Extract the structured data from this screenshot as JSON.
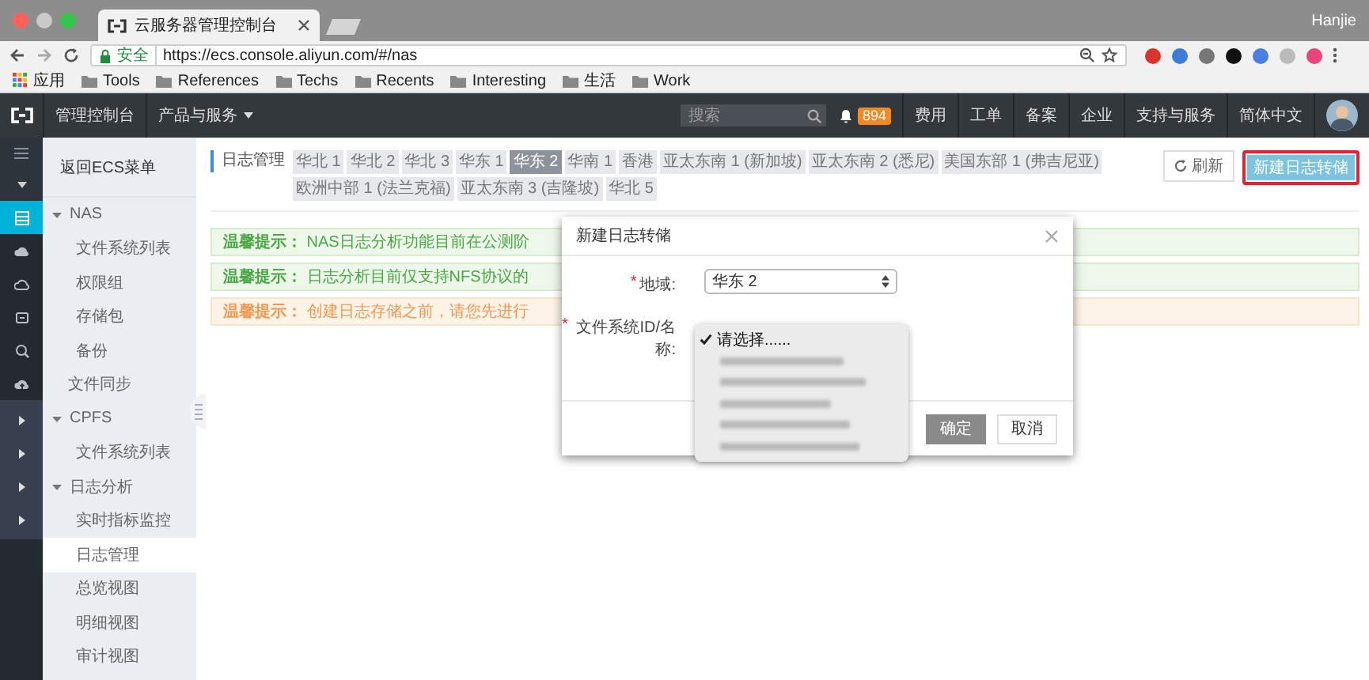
{
  "browser": {
    "tab_title": "云服务器管理控制台",
    "profile_name": "Hanjie",
    "security_label": "安全",
    "url": "https://ecs.console.aliyun.com/#/nas",
    "bookmarks": [
      {
        "label": "应用",
        "kind": "apps"
      },
      {
        "label": "Tools",
        "kind": "folder"
      },
      {
        "label": "References",
        "kind": "folder"
      },
      {
        "label": "Techs",
        "kind": "folder"
      },
      {
        "label": "Recents",
        "kind": "folder"
      },
      {
        "label": "Interesting",
        "kind": "folder"
      },
      {
        "label": "生活",
        "kind": "folder"
      },
      {
        "label": "Work",
        "kind": "folder"
      }
    ]
  },
  "console": {
    "home_label": "管理控制台",
    "products_label": "产品与服务",
    "search": {
      "placeholder": "搜索"
    },
    "notification_count": "894",
    "links": [
      "费用",
      "工单",
      "备案",
      "企业",
      "支持与服务",
      "简体中文"
    ]
  },
  "icon_rail": {
    "items": [
      {
        "selected": true
      },
      {
        "selected": false
      },
      {
        "selected": false
      },
      {
        "selected": false
      },
      {
        "selected": false
      },
      {
        "selected": false
      }
    ]
  },
  "sidebar": {
    "back_label": "返回ECS菜单",
    "items": [
      {
        "label": "NAS",
        "expanded": true,
        "selected": false,
        "children": [
          {
            "label": "文件系统列表",
            "selected": false
          },
          {
            "label": "权限组",
            "selected": false
          },
          {
            "label": "存储包",
            "selected": false
          },
          {
            "label": "备份",
            "selected": false
          }
        ]
      },
      {
        "label": "文件同步",
        "selected": false
      },
      {
        "label": "CPFS",
        "expanded": true,
        "selected": false,
        "children": [
          {
            "label": "文件系统列表",
            "selected": false
          }
        ]
      },
      {
        "label": "日志分析",
        "expanded": true,
        "selected": false,
        "children": [
          {
            "label": "实时指标监控",
            "selected": false
          },
          {
            "label": "日志管理",
            "selected": true
          },
          {
            "label": "总览视图",
            "selected": false
          },
          {
            "label": "明细视图",
            "selected": false
          },
          {
            "label": "审计视图",
            "selected": false
          }
        ]
      }
    ]
  },
  "main": {
    "title": "日志管理",
    "region_tabs": [
      {
        "label": "华北 1",
        "selected": false
      },
      {
        "label": "华北 2",
        "selected": false
      },
      {
        "label": "华北 3",
        "selected": false
      },
      {
        "label": "华东 1",
        "selected": false
      },
      {
        "label": "华东 2",
        "selected": true
      },
      {
        "label": "华南 1",
        "selected": false
      },
      {
        "label": "香港",
        "selected": false
      },
      {
        "label": "亚太东南 1 (新加坡)",
        "selected": false
      },
      {
        "label": "亚太东南 2 (悉尼)",
        "selected": false
      },
      {
        "label": "美国东部 1 (弗吉尼亚)",
        "selected": false
      },
      {
        "label": "欧洲中部 1 (法兰克福)",
        "selected": false
      },
      {
        "label": "亚太东南 3 (吉隆坡)",
        "selected": false
      },
      {
        "label": "华北 5",
        "selected": false
      }
    ],
    "refresh_label": "刷新",
    "create_label": "新建日志转储",
    "notices": [
      {
        "kind": "info",
        "text": "**温馨提示：** NAS日志分析功能目前在公测阶"
      },
      {
        "kind": "info",
        "text": "**温馨提示：** 日志分析目前仅支持NFS协议的"
      },
      {
        "kind": "warning",
        "text": "**温馨提示：** 创建日志存储之前，请您先进行"
      }
    ]
  },
  "dialog": {
    "title": "新建日志转储",
    "fields": [
      {
        "label": "地域:",
        "required_mark": "*",
        "value": "华东 2"
      },
      {
        "label": "文件系统ID/名称:",
        "required_mark": "*"
      }
    ],
    "dropdown": {
      "options": [
        {
          "kind": "text",
          "label": "请选择......",
          "checked": true
        },
        {
          "kind": "redacted",
          "checked": false
        },
        {
          "kind": "redacted",
          "checked": false
        },
        {
          "kind": "redacted",
          "checked": false
        },
        {
          "kind": "redacted",
          "checked": false
        },
        {
          "kind": "redacted",
          "checked": false
        }
      ]
    },
    "buttons": [
      {
        "label": "确定",
        "disabled": true
      },
      {
        "label": "取消",
        "disabled": false
      }
    ]
  }
}
